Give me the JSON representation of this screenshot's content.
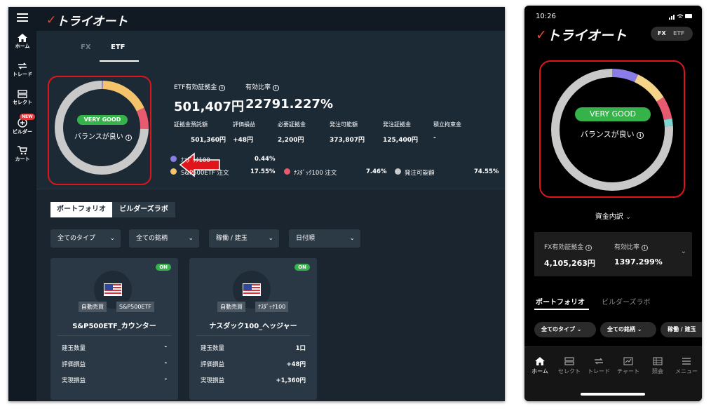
{
  "brand": {
    "logo_text": "トライオート",
    "accent": "#e8492a"
  },
  "desktop": {
    "sidebar": [
      {
        "icon": "home-icon",
        "label": "ホーム"
      },
      {
        "icon": "trade-icon",
        "label": "トレード"
      },
      {
        "icon": "select-icon",
        "label": "セレクト"
      },
      {
        "icon": "builder-icon",
        "label": "ビルダー",
        "badge": "NEW"
      },
      {
        "icon": "cart-icon",
        "label": "カート"
      }
    ],
    "tabs": [
      {
        "label": "FX"
      },
      {
        "label": "ETF"
      }
    ],
    "donut": {
      "badge": "VERY GOOD",
      "text": "バランスが良い",
      "info": "i",
      "segments": [
        {
          "name": "ﾅｽﾀﾞｯｸ100",
          "value": 0.44,
          "color": "#8a7de8"
        },
        {
          "name": "S&P500ETF 注文",
          "value": 17.55,
          "color": "#f5c46a"
        },
        {
          "name": "ﾅｽﾀﾞｯｸ100 注文",
          "value": 7.46,
          "color": "#e85a6f"
        },
        {
          "name": "発注可能額",
          "value": 74.55,
          "color": "#c9c9c9"
        }
      ]
    },
    "metrics": {
      "etf_margin_label": "ETF有効証拠金",
      "etf_margin_value": "501,407円",
      "ratio_label": "有効比率",
      "ratio_value": "22791.227%",
      "small": [
        {
          "label": "証拠金預託額",
          "value": "501,360円"
        },
        {
          "label": "評価損益",
          "value": "+48円"
        },
        {
          "label": "必要証拠金",
          "value": "2,200円"
        },
        {
          "label": "発注可能額",
          "value": "373,807円"
        },
        {
          "label": "発注証拠金",
          "value": "125,400円"
        },
        {
          "label": "積立拘束金",
          "value": "-"
        }
      ],
      "legend": [
        {
          "label": "ﾅｽﾀﾞｯｸ100",
          "value": "0.44%",
          "color": "#8a7de8"
        },
        {
          "label": "S&P500ETF 注文",
          "value": "17.55%",
          "color": "#f5c46a"
        },
        {
          "label": "ﾅｽﾀﾞｯｸ100 注文",
          "value": "7.46%",
          "color": "#e85a6f"
        },
        {
          "label": "発注可能額",
          "value": "74.55%",
          "color": "#c9c9c9"
        }
      ]
    },
    "segment_buttons": [
      {
        "label": "ポートフォリオ"
      },
      {
        "label": "ビルダーズラボ"
      }
    ],
    "filters": [
      {
        "label": "全てのタイプ"
      },
      {
        "label": "全ての銘柄"
      },
      {
        "label": "稼働 / 建玉"
      },
      {
        "label": "日付順"
      }
    ],
    "cards": [
      {
        "status": "ON",
        "tags": [
          "自動売買",
          "S&P500ETF"
        ],
        "title": "S&P500ETF_カウンター",
        "rows": [
          {
            "label": "建玉数量",
            "value": "-"
          },
          {
            "label": "評価損益",
            "value": "-"
          },
          {
            "label": "実現損益",
            "value": "-"
          }
        ]
      },
      {
        "status": "ON",
        "tags": [
          "自動売買",
          "ﾅｽﾀﾞｯｸ100"
        ],
        "title": "ナスダック100_ヘッジャー",
        "rows": [
          {
            "label": "建玉数量",
            "value": "1口"
          },
          {
            "label": "評価損益",
            "value": "+48円"
          },
          {
            "label": "実現損益",
            "value": "+1,360円"
          }
        ]
      }
    ]
  },
  "phone": {
    "time": "10:26",
    "toggle": {
      "fx": "FX",
      "etf": "ETF"
    },
    "donut": {
      "badge": "VERY GOOD",
      "text": "バランスが良い",
      "segments": [
        {
          "value": 7,
          "color": "#8a7de8"
        },
        {
          "value": 9,
          "color": "#f5d48a"
        },
        {
          "value": 6,
          "color": "#e85a6f"
        },
        {
          "value": 2,
          "color": "#7fd6d0"
        },
        {
          "value": 76,
          "color": "#c9c9c9"
        }
      ]
    },
    "breakdown_label": "資金内訳",
    "fx_margin_label": "FX有効証拠金",
    "fx_margin_value": "4,105,263円",
    "ratio_label": "有効比率",
    "ratio_value": "1397.299%",
    "tabs": [
      {
        "label": "ポートフォリオ"
      },
      {
        "label": "ビルダーズラボ"
      }
    ],
    "chips": [
      {
        "label": "全てのタイプ"
      },
      {
        "label": "全ての銘柄"
      },
      {
        "label": "稼働 / 建玉"
      }
    ],
    "nav": [
      {
        "icon": "home-icon",
        "label": "ホーム"
      },
      {
        "icon": "select-icon",
        "label": "セレクト"
      },
      {
        "icon": "trade-icon",
        "label": "トレード"
      },
      {
        "icon": "chart-icon",
        "label": "チャート"
      },
      {
        "icon": "inquiry-icon",
        "label": "照会"
      },
      {
        "icon": "menu-icon",
        "label": "メニュー"
      }
    ]
  }
}
